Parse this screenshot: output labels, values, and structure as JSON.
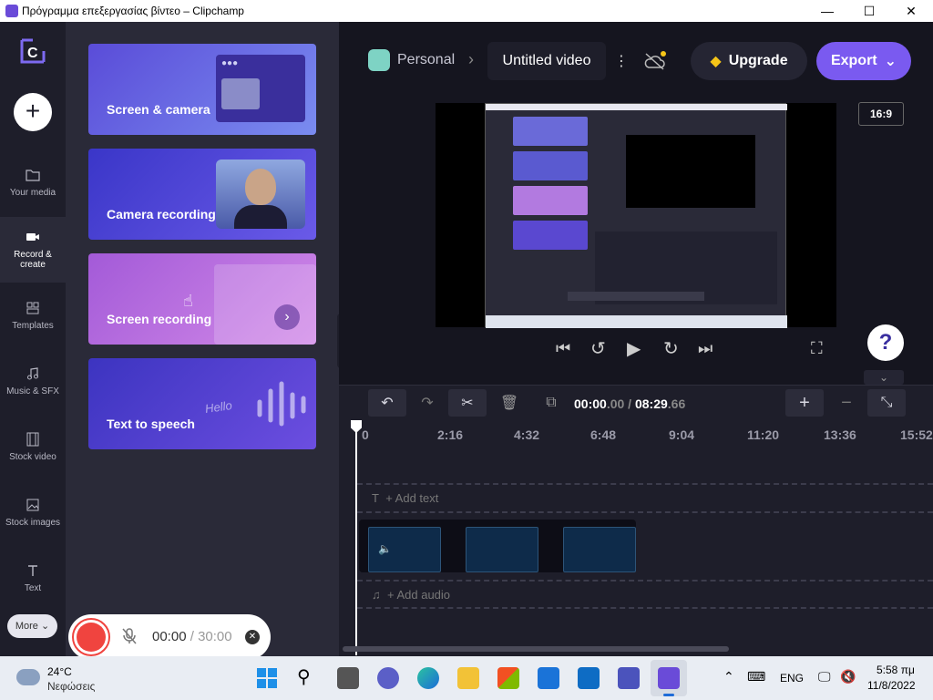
{
  "window": {
    "title": "Πρόγραμμα επεξεργασίας βίντεο – Clipchamp",
    "min_glyph": "—",
    "max_glyph": "☐",
    "close_glyph": "✕"
  },
  "nav": {
    "add_glyph": "+",
    "items": [
      {
        "label": "Your media",
        "icon": "folder-icon"
      },
      {
        "label_line1": "Record &",
        "label_line2": "create",
        "icon": "camera-icon"
      },
      {
        "label": "Templates",
        "icon": "templates-icon"
      },
      {
        "label": "Music & SFX",
        "icon": "music-note-icon"
      },
      {
        "label": "Stock video",
        "icon": "film-icon"
      },
      {
        "label": "Stock images",
        "icon": "image-icon"
      },
      {
        "label": "Text",
        "icon": "text-icon"
      }
    ],
    "more_label": "More"
  },
  "panel": {
    "cards": [
      {
        "label": "Screen & camera"
      },
      {
        "label": "Camera recording"
      },
      {
        "label": "Screen recording"
      },
      {
        "label": "Text to speech",
        "decor_text": "Hello"
      }
    ]
  },
  "header": {
    "workspace": "Personal",
    "breadcrumb_sep": "›",
    "video_title": "Untitled video",
    "more_glyph": "⋮",
    "upgrade_label": "Upgrade",
    "export_label": "Export"
  },
  "preview": {
    "aspect_label": "16:9",
    "help_glyph": "?"
  },
  "timeline": {
    "time_current": "00:00",
    "time_current_frac": ".00",
    "time_sep": "/",
    "time_total": "08:29",
    "time_total_frac": ".66",
    "ticks": [
      "0",
      "2:16",
      "4:32",
      "6:48",
      "9:04",
      "11:20",
      "13:36",
      "15:52"
    ],
    "add_text": "+ Add text",
    "add_audio": "+ Add audio"
  },
  "recbar": {
    "time": "00:00",
    "sep": "/",
    "max": "30:00"
  },
  "taskbar": {
    "temp": "24°C",
    "weather": "Νεφώσεις",
    "lang": "ENG",
    "time": "5:58 πμ",
    "date": "11/8/2022"
  },
  "colors": {
    "accent": "#6a4bd8",
    "export": "#7a5af0",
    "record": "#f0443f",
    "app_bg": "#1e1e2a"
  }
}
